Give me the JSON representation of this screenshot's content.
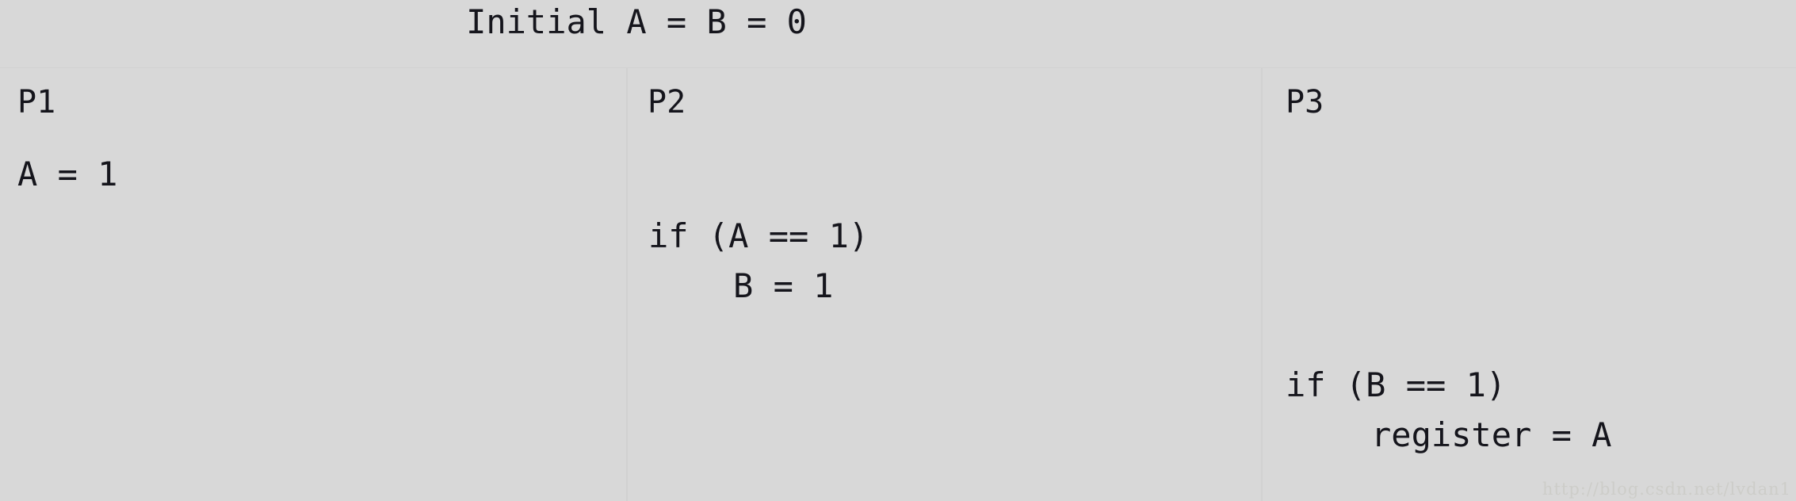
{
  "figure": {
    "background_color": "#d8d8d8",
    "text_color": "#15151c",
    "divider_color": "#d1d1d1",
    "title": "Initial A = B = 0"
  },
  "columns": [
    {
      "id": "p1",
      "title": "P1",
      "lines": [
        {
          "text": "A = 1",
          "indent": 0
        }
      ]
    },
    {
      "id": "p2",
      "title": "P2",
      "lines": [
        {
          "text": "if (A == 1)",
          "indent": 0
        },
        {
          "text": "B = 1",
          "indent": 4
        }
      ]
    },
    {
      "id": "p3",
      "title": "P3",
      "lines": [
        {
          "text": "if (B == 1)",
          "indent": 0
        },
        {
          "text": "register = A",
          "indent": 4
        }
      ]
    }
  ],
  "watermark": {
    "text": "http://blog.csdn.net/lvdan1",
    "color": "#cdcdc9"
  }
}
